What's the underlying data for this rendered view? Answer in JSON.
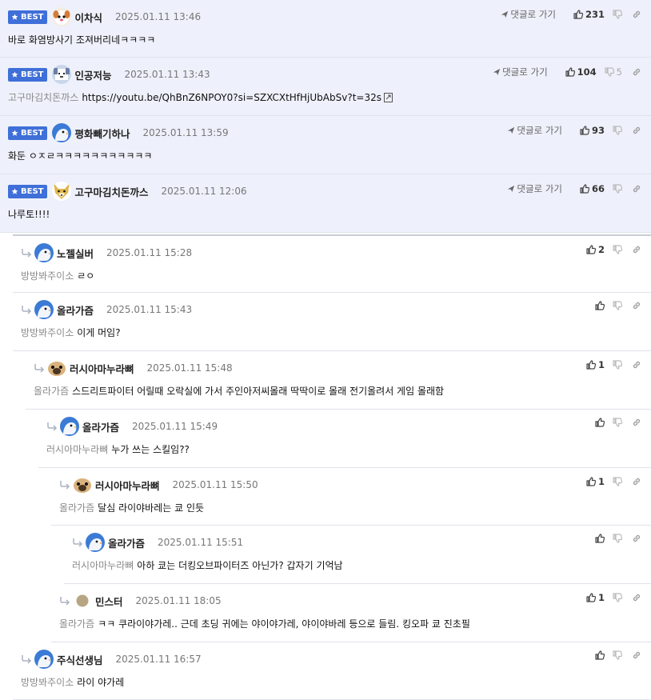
{
  "labels": {
    "best": "BEST",
    "reply_to": "댓글로 가기"
  },
  "colors": {
    "best_bg": "#eef1fb",
    "badge": "#3f6fd8"
  },
  "comments": [
    {
      "nick": "이차식",
      "date": "2025.01.11 13:46",
      "mention": "",
      "text": "바로 화염방사기 조져버리네ㅋㅋㅋㅋ",
      "up": "231",
      "down": "",
      "best": true,
      "avatar": "dog-face-avatar"
    },
    {
      "nick": "인공저능",
      "date": "2025.01.11 13:43",
      "mention": "고구마김치돈까스",
      "text": "https://youtu.be/QhBnZ6NPOY0?si=SZXCXtHfHjUbAbSv?t=32s",
      "up": "104",
      "down": "5",
      "best": true,
      "avatar": "dog-pixel-avatar"
    },
    {
      "nick": "평화빼기하나",
      "date": "2025.01.11 13:59",
      "mention": "",
      "text": "화둔 ㅇㅈㄹㅋㅋㅋㅋㅋㅋㅋㅋㅋㅋㅋ",
      "up": "93",
      "down": "",
      "best": true,
      "avatar": "bird-avatar"
    },
    {
      "nick": "고구마김치돈까스",
      "date": "2025.01.11 12:06",
      "mention": "",
      "text": "나루토!!!!",
      "up": "66",
      "down": "",
      "best": true,
      "avatar": "fox-avatar"
    },
    {
      "nick": "노젤실버",
      "date": "2025.01.11 15:28",
      "mention": "방방봐주이소",
      "text": "ㄹㅇ",
      "up": "2",
      "down": "",
      "best": false,
      "avatar": "bird-avatar"
    },
    {
      "nick": "올라가즘",
      "date": "2025.01.11 15:43",
      "mention": "방방봐주이소",
      "text": "이게 머임?",
      "up": "",
      "down": "",
      "best": false,
      "avatar": "bird-avatar"
    },
    {
      "nick": "러시아마누라뼈",
      "date": "2025.01.11 15:48",
      "mention": "올라가즘",
      "text": "스드리트파이터 어릴때 오락실에 가서 주인아저씨몰래 딱딱이로 몰래 전기올려서 게임 몰래함",
      "up": "1",
      "down": "",
      "best": false,
      "avatar": "pug-avatar"
    },
    {
      "nick": "올라가즘",
      "date": "2025.01.11 15:49",
      "mention": "러시아마누라뼈",
      "text": "누가 쓰는 스킬임??",
      "up": "",
      "down": "",
      "best": false,
      "avatar": "bird-avatar"
    },
    {
      "nick": "러시아마누라뼈",
      "date": "2025.01.11 15:50",
      "mention": "올라가즘",
      "text": "달심 라이야바레는 쿄 인듯",
      "up": "1",
      "down": "",
      "best": false,
      "avatar": "pug-avatar"
    },
    {
      "nick": "올라가즘",
      "date": "2025.01.11 15:51",
      "mention": "러시아마누라뼈",
      "text": "아하 쿄는 더킹오브파이터즈 아닌가? 갑자기 기억남",
      "up": "",
      "down": "",
      "best": false,
      "avatar": "bird-avatar"
    },
    {
      "nick": "민스터",
      "date": "2025.01.11 18:05",
      "mention": "올라가즘",
      "text": "ㅋㅋ 쿠라이야가레.. 근데 초딩 귀에는 야이야가레, 야이야바레 등으로 들림. 킹오파 쿄 진초필",
      "up": "1",
      "down": "",
      "best": false,
      "avatar": "dot-avatar"
    },
    {
      "nick": "주식선생님",
      "date": "2025.01.11 16:57",
      "mention": "방방봐주이소",
      "text": "라이 야가레",
      "up": "",
      "down": "",
      "best": false,
      "avatar": "bird-avatar"
    }
  ]
}
